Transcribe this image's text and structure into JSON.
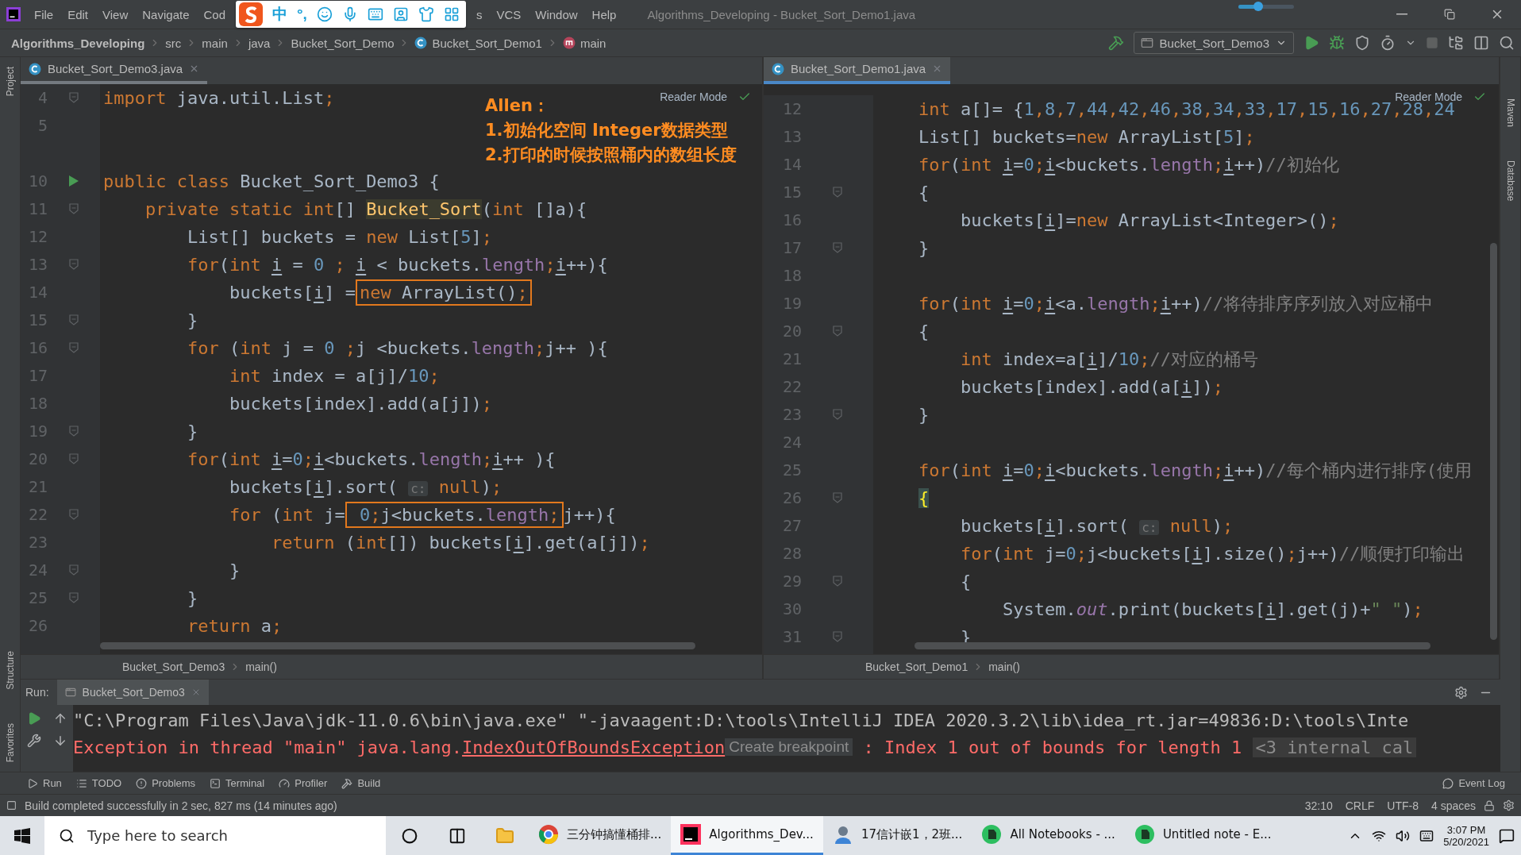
{
  "title_bar": {
    "menus": [
      "File",
      "Edit",
      "View",
      "Navigate",
      "Cod"
    ],
    "menus_after_ime": [
      "s",
      "VCS",
      "Window",
      "Help"
    ],
    "title": "Algorithms_Developing - Bucket_Sort_Demo1.java",
    "ime_labels": [
      "中",
      "°,"
    ],
    "slider": {
      "level": 0.35
    }
  },
  "nav_bar": {
    "crumbs": [
      {
        "label": "Algorithms_Developing",
        "kind": "project"
      },
      {
        "label": "src",
        "kind": "folder"
      },
      {
        "label": "main",
        "kind": "folder"
      },
      {
        "label": "java",
        "kind": "folder"
      },
      {
        "label": "Bucket_Sort_Demo",
        "kind": "folder"
      },
      {
        "label": "Bucket_Sort_Demo1",
        "kind": "class"
      },
      {
        "label": "main",
        "kind": "method"
      }
    ],
    "run_config": "Bucket_Sort_Demo3"
  },
  "side_stripes": {
    "left_top": [
      "Project"
    ],
    "left_bottom": [
      "Structure",
      "Favorites"
    ],
    "right": [
      "Maven",
      "Database"
    ]
  },
  "annotation": {
    "lines": [
      "Allen：",
      "1.初始化空间 Integer数据类型",
      "2.打印的时候按照桶内的数组长度"
    ]
  },
  "editors": [
    {
      "tab": {
        "label": "Bucket_Sort_Demo3.java",
        "selected": false
      },
      "reader_mode": "Reader Mode",
      "breadcrumb": [
        "Bucket_Sort_Demo3",
        "main()"
      ],
      "lines": [
        {
          "number": "4",
          "kind": "fold",
          "tokens": [
            {
              "kind": "keyword",
              "text": "import"
            },
            {
              "kind": "plain",
              "text": " java.util.List"
            },
            {
              "kind": "keyword",
              "text": ";"
            }
          ]
        },
        {
          "number": "5",
          "kind": "plain"
        },
        {
          "kind": "plain"
        },
        {
          "number": "10",
          "kind": "run",
          "tokens": [
            {
              "kind": "keyword",
              "text": "public class "
            },
            {
              "kind": "plain",
              "text": "Bucket_Sort_Demo3 {"
            }
          ]
        },
        {
          "number": "11",
          "kind": "fold",
          "tokens": [
            {
              "kind": "keyword",
              "text": "    private static int"
            },
            {
              "kind": "plain",
              "text": "[] "
            },
            {
              "kind": "declaration",
              "text": "Bucket_Sort"
            },
            {
              "kind": "plain",
              "text": "("
            },
            {
              "kind": "keyword",
              "text": "int "
            },
            {
              "kind": "plain",
              "text": "[]a){"
            }
          ]
        },
        {
          "number": "12",
          "kind": "plain",
          "tokens": [
            {
              "kind": "plain",
              "text": "        List[] buckets = "
            },
            {
              "kind": "keyword",
              "text": "new "
            },
            {
              "kind": "plain",
              "text": "List["
            },
            {
              "kind": "number",
              "text": "5"
            },
            {
              "kind": "plain",
              "text": "]"
            },
            {
              "kind": "keyword",
              "text": ";"
            }
          ]
        },
        {
          "number": "13",
          "kind": "fold",
          "tokens": [
            {
              "kind": "keyword",
              "text": "        for"
            },
            {
              "kind": "plain",
              "text": "("
            },
            {
              "kind": "keyword",
              "text": "int "
            },
            {
              "kind": "variable",
              "text": "i"
            },
            {
              "kind": "plain",
              "text": " = "
            },
            {
              "kind": "number",
              "text": "0"
            },
            {
              "kind": "keyword",
              "text": " ; "
            },
            {
              "kind": "variable",
              "text": "i"
            },
            {
              "kind": "plain",
              "text": " < buckets."
            },
            {
              "kind": "field",
              "text": "length"
            },
            {
              "kind": "keyword",
              "text": ";"
            },
            {
              "kind": "variable",
              "text": "i"
            },
            {
              "kind": "plain",
              "text": "++){"
            }
          ]
        },
        {
          "number": "14",
          "kind": "plain",
          "tokens": [
            {
              "kind": "plain",
              "text": "            buckets["
            },
            {
              "kind": "variable",
              "text": "i"
            },
            {
              "kind": "plain",
              "text": "] ="
            },
            {
              "kind": "box",
              "children": [
                {
                  "kind": "keyword",
                  "text": "new "
                },
                {
                  "kind": "plain",
                  "text": "ArrayList()"
                },
                {
                  "kind": "keyword",
                  "text": ";"
                }
              ]
            }
          ]
        },
        {
          "number": "15",
          "kind": "fold",
          "tokens": [
            {
              "kind": "plain",
              "text": "        }"
            }
          ]
        },
        {
          "number": "16",
          "kind": "fold",
          "tokens": [
            {
              "kind": "keyword",
              "text": "        for "
            },
            {
              "kind": "plain",
              "text": "("
            },
            {
              "kind": "keyword",
              "text": "int "
            },
            {
              "kind": "plain",
              "text": "j = "
            },
            {
              "kind": "number",
              "text": "0"
            },
            {
              "kind": "keyword",
              "text": " ;"
            },
            {
              "kind": "plain",
              "text": "j <buckets."
            },
            {
              "kind": "field",
              "text": "length"
            },
            {
              "kind": "keyword",
              "text": ";"
            },
            {
              "kind": "plain",
              "text": "j++ ){"
            }
          ]
        },
        {
          "number": "17",
          "kind": "plain",
          "tokens": [
            {
              "kind": "keyword",
              "text": "            int "
            },
            {
              "kind": "plain",
              "text": "index = a[j]/"
            },
            {
              "kind": "number",
              "text": "10"
            },
            {
              "kind": "keyword",
              "text": ";"
            }
          ]
        },
        {
          "number": "18",
          "kind": "plain",
          "tokens": [
            {
              "kind": "plain",
              "text": "            buckets[index].add(a[j])"
            },
            {
              "kind": "keyword",
              "text": ";"
            }
          ]
        },
        {
          "number": "19",
          "kind": "fold",
          "tokens": [
            {
              "kind": "plain",
              "text": "        }"
            }
          ]
        },
        {
          "number": "20",
          "kind": "fold",
          "tokens": [
            {
              "kind": "keyword",
              "text": "        for"
            },
            {
              "kind": "plain",
              "text": "("
            },
            {
              "kind": "keyword",
              "text": "int "
            },
            {
              "kind": "variable",
              "text": "i"
            },
            {
              "kind": "plain",
              "text": "="
            },
            {
              "kind": "number",
              "text": "0"
            },
            {
              "kind": "keyword",
              "text": ";"
            },
            {
              "kind": "variable",
              "text": "i"
            },
            {
              "kind": "plain",
              "text": "<buckets."
            },
            {
              "kind": "field",
              "text": "length"
            },
            {
              "kind": "keyword",
              "text": ";"
            },
            {
              "kind": "variable",
              "text": "i"
            },
            {
              "kind": "plain",
              "text": "++ ){"
            }
          ]
        },
        {
          "number": "21",
          "kind": "plain",
          "tokens": [
            {
              "kind": "plain",
              "text": "            buckets["
            },
            {
              "kind": "variable",
              "text": "i"
            },
            {
              "kind": "plain",
              "text": "].sort( "
            },
            {
              "kind": "hint",
              "text": "c:"
            },
            {
              "kind": "keyword",
              "text": " null"
            },
            {
              "kind": "plain",
              "text": ")"
            },
            {
              "kind": "keyword",
              "text": ";"
            }
          ]
        },
        {
          "number": "22",
          "kind": "fold",
          "tokens": [
            {
              "kind": "keyword",
              "text": "            for "
            },
            {
              "kind": "plain",
              "text": "("
            },
            {
              "kind": "keyword",
              "text": "int "
            },
            {
              "kind": "plain",
              "text": "j="
            },
            {
              "kind": "box",
              "children": [
                {
                  "kind": "number",
                  "text": " 0"
                },
                {
                  "kind": "keyword",
                  "text": ";"
                },
                {
                  "kind": "plain",
                  "text": "j<buckets."
                },
                {
                  "kind": "field",
                  "text": "length"
                },
                {
                  "kind": "keyword",
                  "text": ";"
                }
              ]
            },
            {
              "kind": "plain",
              "text": "j++){"
            }
          ]
        },
        {
          "number": "23",
          "kind": "plain",
          "tokens": [
            {
              "kind": "keyword",
              "text": "                return "
            },
            {
              "kind": "plain",
              "text": "("
            },
            {
              "kind": "keyword",
              "text": "int"
            },
            {
              "kind": "plain",
              "text": "[]) buckets["
            },
            {
              "kind": "variable",
              "text": "i"
            },
            {
              "kind": "plain",
              "text": "].get(a[j])"
            },
            {
              "kind": "keyword",
              "text": ";"
            }
          ]
        },
        {
          "number": "24",
          "kind": "fold",
          "tokens": [
            {
              "kind": "plain",
              "text": "            }"
            }
          ]
        },
        {
          "number": "25",
          "kind": "fold",
          "tokens": [
            {
              "kind": "plain",
              "text": "        }"
            }
          ]
        },
        {
          "number": "26",
          "kind": "plain",
          "tokens": [
            {
              "kind": "keyword",
              "text": "        return "
            },
            {
              "kind": "plain",
              "text": "a"
            },
            {
              "kind": "keyword",
              "text": ";"
            }
          ]
        }
      ]
    },
    {
      "tab": {
        "label": "Bucket_Sort_Demo1.java",
        "selected": true
      },
      "reader_mode": "Reader Mode",
      "breadcrumb": [
        "Bucket_Sort_Demo1",
        "main()"
      ],
      "lines": [
        {
          "number": "12",
          "kind": "plain",
          "tokens": [
            {
              "kind": "keyword",
              "text": "    int "
            },
            {
              "kind": "plain",
              "text": "a[]= {"
            },
            {
              "kind": "number",
              "text": "1"
            },
            {
              "kind": "keyword",
              "text": ","
            },
            {
              "kind": "number",
              "text": "8"
            },
            {
              "kind": "keyword",
              "text": ","
            },
            {
              "kind": "number",
              "text": "7"
            },
            {
              "kind": "keyword",
              "text": ","
            },
            {
              "kind": "number",
              "text": "44"
            },
            {
              "kind": "keyword",
              "text": ","
            },
            {
              "kind": "number",
              "text": "42"
            },
            {
              "kind": "keyword",
              "text": ","
            },
            {
              "kind": "number",
              "text": "46"
            },
            {
              "kind": "keyword",
              "text": ","
            },
            {
              "kind": "number",
              "text": "38"
            },
            {
              "kind": "keyword",
              "text": ","
            },
            {
              "kind": "number",
              "text": "34"
            },
            {
              "kind": "keyword",
              "text": ","
            },
            {
              "kind": "number",
              "text": "33"
            },
            {
              "kind": "keyword",
              "text": ","
            },
            {
              "kind": "number",
              "text": "17"
            },
            {
              "kind": "keyword",
              "text": ","
            },
            {
              "kind": "number",
              "text": "15"
            },
            {
              "kind": "keyword",
              "text": ","
            },
            {
              "kind": "number",
              "text": "16"
            },
            {
              "kind": "keyword",
              "text": ","
            },
            {
              "kind": "number",
              "text": "27"
            },
            {
              "kind": "keyword",
              "text": ","
            },
            {
              "kind": "number",
              "text": "28"
            },
            {
              "kind": "keyword",
              "text": ","
            },
            {
              "kind": "number",
              "text": "24"
            }
          ]
        },
        {
          "number": "13",
          "kind": "plain",
          "tokens": [
            {
              "kind": "plain",
              "text": "    List[] buckets="
            },
            {
              "kind": "keyword",
              "text": "new "
            },
            {
              "kind": "plain",
              "text": "ArrayList["
            },
            {
              "kind": "number",
              "text": "5"
            },
            {
              "kind": "plain",
              "text": "]"
            },
            {
              "kind": "keyword",
              "text": ";"
            }
          ]
        },
        {
          "number": "14",
          "kind": "plain",
          "tokens": [
            {
              "kind": "keyword",
              "text": "    for"
            },
            {
              "kind": "plain",
              "text": "("
            },
            {
              "kind": "keyword",
              "text": "int "
            },
            {
              "kind": "variable",
              "text": "i"
            },
            {
              "kind": "plain",
              "text": "="
            },
            {
              "kind": "number",
              "text": "0"
            },
            {
              "kind": "keyword",
              "text": ";"
            },
            {
              "kind": "variable",
              "text": "i"
            },
            {
              "kind": "plain",
              "text": "<buckets."
            },
            {
              "kind": "field",
              "text": "length"
            },
            {
              "kind": "keyword",
              "text": ";"
            },
            {
              "kind": "variable",
              "text": "i"
            },
            {
              "kind": "plain",
              "text": "++)"
            },
            {
              "kind": "comment",
              "text": "//初始化"
            }
          ]
        },
        {
          "number": "15",
          "kind": "fold",
          "tokens": [
            {
              "kind": "plain",
              "text": "    {"
            }
          ]
        },
        {
          "number": "16",
          "kind": "plain",
          "tokens": [
            {
              "kind": "plain",
              "text": "        buckets["
            },
            {
              "kind": "variable",
              "text": "i"
            },
            {
              "kind": "plain",
              "text": "]="
            },
            {
              "kind": "keyword",
              "text": "new "
            },
            {
              "kind": "plain",
              "text": "ArrayList<Integer>()"
            },
            {
              "kind": "keyword",
              "text": ";"
            }
          ]
        },
        {
          "number": "17",
          "kind": "fold",
          "tokens": [
            {
              "kind": "plain",
              "text": "    }"
            }
          ]
        },
        {
          "number": "18",
          "kind": "plain"
        },
        {
          "number": "19",
          "kind": "plain",
          "tokens": [
            {
              "kind": "keyword",
              "text": "    for"
            },
            {
              "kind": "plain",
              "text": "("
            },
            {
              "kind": "keyword",
              "text": "int "
            },
            {
              "kind": "variable",
              "text": "i"
            },
            {
              "kind": "plain",
              "text": "="
            },
            {
              "kind": "number",
              "text": "0"
            },
            {
              "kind": "keyword",
              "text": ";"
            },
            {
              "kind": "variable",
              "text": "i"
            },
            {
              "kind": "plain",
              "text": "<a."
            },
            {
              "kind": "field",
              "text": "length"
            },
            {
              "kind": "keyword",
              "text": ";"
            },
            {
              "kind": "variable",
              "text": "i"
            },
            {
              "kind": "plain",
              "text": "++)"
            },
            {
              "kind": "comment",
              "text": "//将待排序序列放入对应桶中"
            }
          ]
        },
        {
          "number": "20",
          "kind": "fold",
          "tokens": [
            {
              "kind": "plain",
              "text": "    {"
            }
          ]
        },
        {
          "number": "21",
          "kind": "plain",
          "tokens": [
            {
              "kind": "keyword",
              "text": "        int "
            },
            {
              "kind": "plain",
              "text": "index=a["
            },
            {
              "kind": "variable",
              "text": "i"
            },
            {
              "kind": "plain",
              "text": "]/"
            },
            {
              "kind": "number",
              "text": "10"
            },
            {
              "kind": "keyword",
              "text": ";"
            },
            {
              "kind": "comment",
              "text": "//对应的桶号"
            }
          ]
        },
        {
          "number": "22",
          "kind": "plain",
          "tokens": [
            {
              "kind": "plain",
              "text": "        buckets[index].add(a["
            },
            {
              "kind": "variable",
              "text": "i"
            },
            {
              "kind": "plain",
              "text": "])"
            },
            {
              "kind": "keyword",
              "text": ";"
            }
          ]
        },
        {
          "number": "23",
          "kind": "fold",
          "tokens": [
            {
              "kind": "plain",
              "text": "    }"
            }
          ]
        },
        {
          "number": "24",
          "kind": "plain"
        },
        {
          "number": "25",
          "kind": "plain",
          "tokens": [
            {
              "kind": "keyword",
              "text": "    for"
            },
            {
              "kind": "plain",
              "text": "("
            },
            {
              "kind": "keyword",
              "text": "int "
            },
            {
              "kind": "variable",
              "text": "i"
            },
            {
              "kind": "plain",
              "text": "="
            },
            {
              "kind": "number",
              "text": "0"
            },
            {
              "kind": "keyword",
              "text": ";"
            },
            {
              "kind": "variable",
              "text": "i"
            },
            {
              "kind": "plain",
              "text": "<buckets."
            },
            {
              "kind": "field",
              "text": "length"
            },
            {
              "kind": "keyword",
              "text": ";"
            },
            {
              "kind": "variable",
              "text": "i"
            },
            {
              "kind": "plain",
              "text": "++)"
            },
            {
              "kind": "comment",
              "text": "//每个桶内进行排序(使用"
            }
          ]
        },
        {
          "number": "26",
          "kind": "fold",
          "tokens": [
            {
              "kind": "brace",
              "text": "    {"
            }
          ]
        },
        {
          "number": "27",
          "kind": "plain",
          "tokens": [
            {
              "kind": "plain",
              "text": "        buckets["
            },
            {
              "kind": "variable",
              "text": "i"
            },
            {
              "kind": "plain",
              "text": "].sort( "
            },
            {
              "kind": "hint",
              "text": "c:"
            },
            {
              "kind": "keyword",
              "text": " null"
            },
            {
              "kind": "plain",
              "text": ")"
            },
            {
              "kind": "keyword",
              "text": ";"
            }
          ]
        },
        {
          "number": "28",
          "kind": "plain",
          "tokens": [
            {
              "kind": "keyword",
              "text": "        for"
            },
            {
              "kind": "plain",
              "text": "("
            },
            {
              "kind": "keyword",
              "text": "int "
            },
            {
              "kind": "plain",
              "text": "j="
            },
            {
              "kind": "number",
              "text": "0"
            },
            {
              "kind": "keyword",
              "text": ";"
            },
            {
              "kind": "plain",
              "text": "j<buckets["
            },
            {
              "kind": "variable",
              "text": "i"
            },
            {
              "kind": "plain",
              "text": "].size()"
            },
            {
              "kind": "keyword",
              "text": ";"
            },
            {
              "kind": "plain",
              "text": "j++)"
            },
            {
              "kind": "comment",
              "text": "//顺便打印输出"
            }
          ]
        },
        {
          "number": "29",
          "kind": "fold",
          "tokens": [
            {
              "kind": "plain",
              "text": "        {"
            }
          ]
        },
        {
          "number": "30",
          "kind": "plain",
          "tokens": [
            {
              "kind": "plain",
              "text": "            System."
            },
            {
              "kind": "static",
              "text": "out"
            },
            {
              "kind": "plain",
              "text": ".print(buckets["
            },
            {
              "kind": "variable",
              "text": "i"
            },
            {
              "kind": "plain",
              "text": "].get(j)+"
            },
            {
              "kind": "string",
              "text": "\" \""
            },
            {
              "kind": "plain",
              "text": ")"
            },
            {
              "kind": "keyword",
              "text": ";"
            }
          ]
        },
        {
          "number": "31",
          "kind": "fold",
          "tokens": [
            {
              "kind": "plain",
              "text": "        }"
            }
          ]
        }
      ]
    }
  ],
  "run_panel": {
    "label": "Run:",
    "tab": "Bucket_Sort_Demo3",
    "output": [
      [
        {
          "kind": "command",
          "text": "\"C:\\Program Files\\Java\\jdk-11.0.6\\bin\\java.exe\" \"-javaagent:D:\\tools\\IntelliJ IDEA 2020.3.2\\lib\\idea_rt.jar=49836:D:\\tools\\Inte"
        }
      ],
      [
        {
          "kind": "error",
          "text": "Exception in thread \"main\" java.lang."
        },
        {
          "kind": "link",
          "text": "IndexOutOfBoundsException"
        },
        {
          "kind": "chip",
          "text": "Create breakpoint"
        },
        {
          "kind": "error",
          "text": " : Index 1 out of bounds for length 1 "
        },
        {
          "kind": "folded",
          "text": "<3 internal cal"
        }
      ]
    ]
  },
  "tool_windows": [
    {
      "label": "Run",
      "kind": "run"
    },
    {
      "label": "TODO",
      "kind": "todo"
    },
    {
      "label": "Problems",
      "kind": "problems"
    },
    {
      "label": "Terminal",
      "kind": "terminal"
    },
    {
      "label": "Profiler",
      "kind": "profiler"
    },
    {
      "label": "Build",
      "kind": "build"
    }
  ],
  "event_log": "Event Log",
  "status_bar": {
    "message": "Build completed successfully in 2 sec, 827 ms (14 minutes ago)",
    "items": [
      "32:10",
      "CRLF",
      "UTF-8",
      "4 spaces"
    ]
  },
  "taskbar": {
    "search_placeholder": "Type here to search",
    "apps": [
      {
        "label": "三分钟搞懂桶排...",
        "kind": "browser",
        "selected": false
      },
      {
        "label": "Algorithms_Dev...",
        "kind": "ide",
        "selected": true
      },
      {
        "label": "17信计嵌1，2班...",
        "kind": "chat",
        "selected": false
      },
      {
        "label": "All Notebooks - ...",
        "kind": "notes",
        "selected": false
      },
      {
        "label": "Untitled note - E...",
        "kind": "notes",
        "selected": false
      }
    ],
    "time": "3:07 PM",
    "date": "5/20/2021"
  }
}
